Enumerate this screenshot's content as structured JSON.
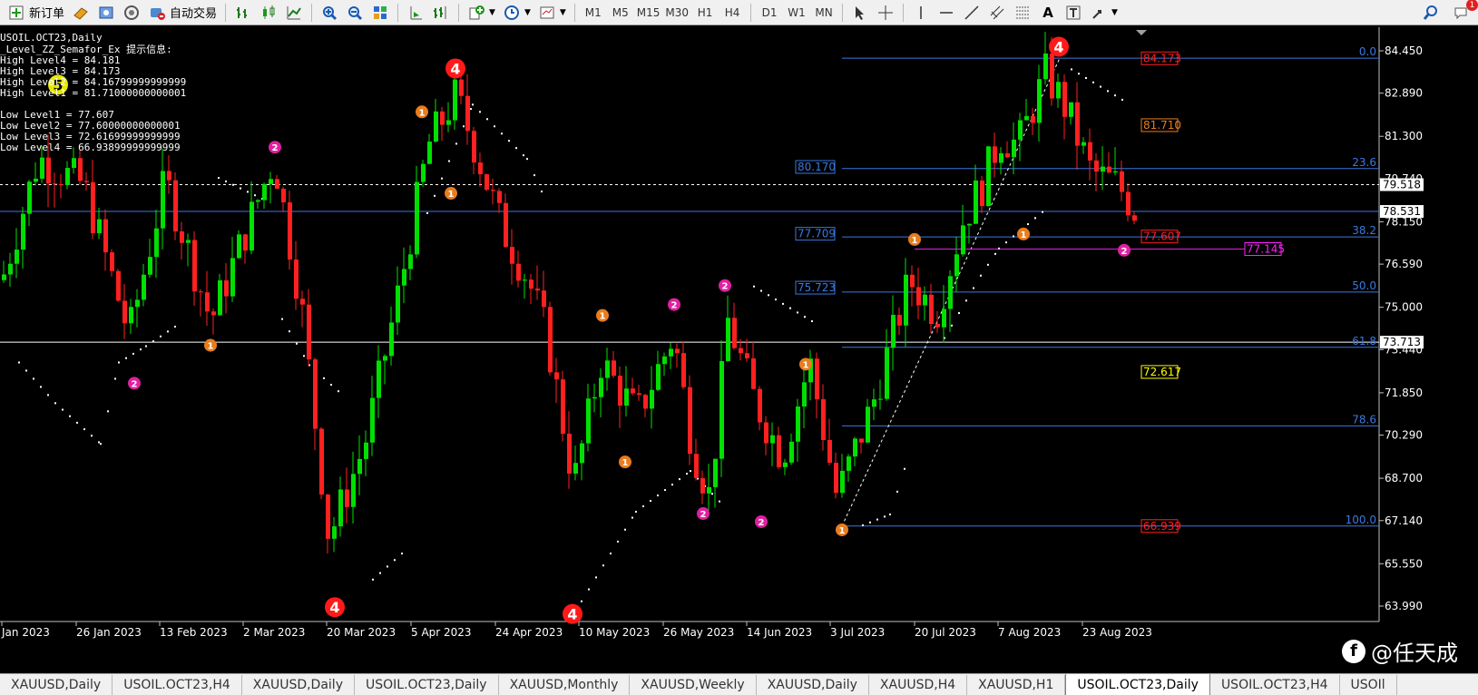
{
  "toolbar": {
    "new_order": "新订单",
    "auto_trading": "自动交易",
    "timeframes": [
      "M1",
      "M5",
      "M15",
      "M30",
      "H1",
      "H4",
      "D1",
      "W1",
      "MN"
    ],
    "notification_count": "1"
  },
  "info": {
    "symbol_line": "USOIL.OCT23,Daily",
    "indicator_line": "_Level_ZZ_Semafor_Ex 提示信息:",
    "high_lines": [
      "High Level4 = 84.181",
      "High Level3 = 84.173",
      "High Level2 = 84.16799999999999",
      "High Level1 = 81.71000000000001"
    ],
    "low_lines": [
      "Low Level1 = 77.607",
      "Low Level2 = 77.60000000000001",
      "Low Level3 = 72.61699999999999",
      "Low Level4 = 66.93899999999999"
    ]
  },
  "price_axis": {
    "ticks": [
      "84.450",
      "82.890",
      "81.300",
      "79.740",
      "78.150",
      "76.590",
      "75.000",
      "73.440",
      "71.850",
      "70.290",
      "68.700",
      "67.140",
      "65.550",
      "63.990"
    ],
    "current_price": "78.531",
    "dashed_price": "79.518",
    "line_price": "73.713"
  },
  "time_axis": [
    "Jan 2023",
    "26 Jan 2023",
    "13 Feb 2023",
    "2 Mar 2023",
    "20 Mar 2023",
    "5 Apr 2023",
    "24 Apr 2023",
    "10 May 2023",
    "26 May 2023",
    "14 Jun 2023",
    "3 Jul 2023",
    "20 Jul 2023",
    "7 Aug 2023",
    "23 Aug 2023"
  ],
  "fibonacci": {
    "levels": [
      "0.0",
      "23.6",
      "38.2",
      "50.0",
      "61.8",
      "78.6",
      "100.0"
    ],
    "price_tags": [
      "80.170",
      "77.709",
      "75.723"
    ]
  },
  "level_tags": [
    "84.173",
    "81.710",
    "77.607",
    "77.145",
    "72.617",
    "66.939"
  ],
  "colors": {
    "up_candle": "#00e000",
    "down_candle": "#ff2020",
    "fib": "#3a78e0",
    "semafor_small": "#e87d1e",
    "semafor_mid": "#e020a0",
    "semafor_big": "#ff1a1a"
  },
  "tabs": [
    "XAUUSD,Daily",
    "USOIL.OCT23,H4",
    "XAUUSD,Daily",
    "USOIL.OCT23,Daily",
    "XAUUSD,Monthly",
    "XAUUSD,Weekly",
    "XAUUSD,Daily",
    "XAUUSD,H4",
    "XAUUSD,H1",
    "USOIL.OCT23,Daily",
    "USOIL.OCT23,H4",
    "USOIl"
  ],
  "active_tab_index": 9,
  "watermark": "@任天成"
}
